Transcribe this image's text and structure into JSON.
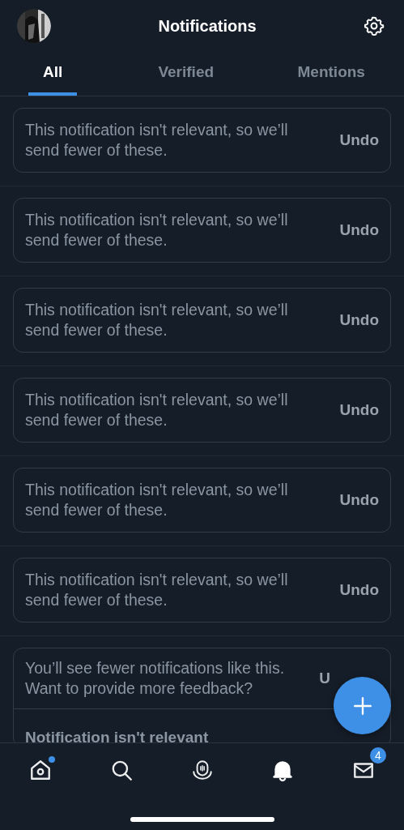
{
  "header": {
    "title": "Notifications"
  },
  "tabs": [
    {
      "label": "All",
      "selected": true
    },
    {
      "label": "Verified",
      "selected": false
    },
    {
      "label": "Mentions",
      "selected": false
    }
  ],
  "notifications": [
    {
      "kind": "dismissed",
      "message": "This notification isn't relevant, so we’ll send fewer of these.",
      "action": "Undo"
    },
    {
      "kind": "dismissed",
      "message": "This notification isn't relevant, so we’ll send fewer of these.",
      "action": "Undo"
    },
    {
      "kind": "dismissed",
      "message": "This notification isn't relevant, so we’ll send fewer of these.",
      "action": "Undo"
    },
    {
      "kind": "dismissed",
      "message": "This notification isn't relevant, so we’ll send fewer of these.",
      "action": "Undo"
    },
    {
      "kind": "dismissed",
      "message": "This notification isn't relevant, so we’ll send fewer of these.",
      "action": "Undo"
    },
    {
      "kind": "dismissed",
      "message": "This notification isn't relevant, so we’ll send fewer of these.",
      "action": "Undo"
    },
    {
      "kind": "feedback",
      "message": "You’ll see fewer notifications like this. Want to provide more feedback?",
      "action": "U",
      "options": [
        "Notification isn't relevant"
      ]
    }
  ],
  "nav": [
    {
      "kind": "home",
      "selected": false,
      "unread": true
    },
    {
      "kind": "search",
      "selected": false,
      "unread": false
    },
    {
      "kind": "spaces",
      "selected": false,
      "unread": false
    },
    {
      "kind": "notifications",
      "selected": true,
      "unread": false
    },
    {
      "kind": "messages",
      "selected": false,
      "unread": false,
      "badge": "4"
    }
  ]
}
